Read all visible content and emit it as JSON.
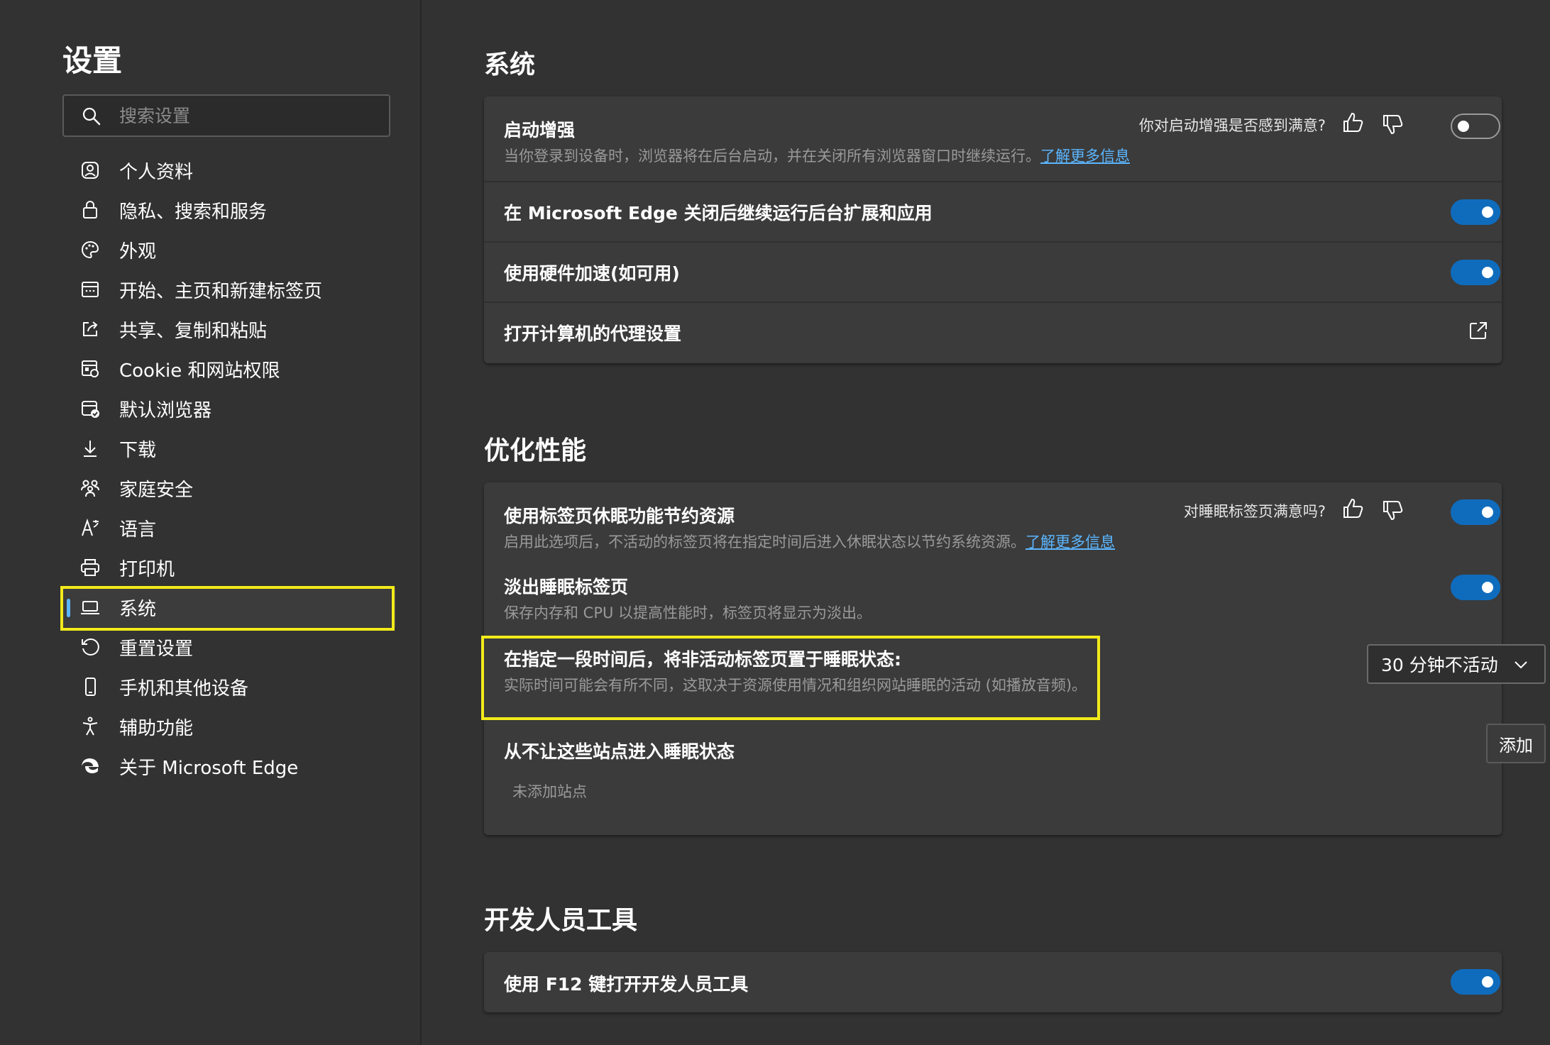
{
  "sidebar": {
    "title": "设置",
    "search_placeholder": "搜索设置",
    "items": [
      {
        "label": "个人资料",
        "icon": "profile-icon"
      },
      {
        "label": "隐私、搜索和服务",
        "icon": "lock-icon"
      },
      {
        "label": "外观",
        "icon": "palette-icon"
      },
      {
        "label": "开始、主页和新建标签页",
        "icon": "home-tab-icon"
      },
      {
        "label": "共享、复制和粘贴",
        "icon": "share-icon"
      },
      {
        "label": "Cookie 和网站权限",
        "icon": "cookie-icon"
      },
      {
        "label": "默认浏览器",
        "icon": "browser-icon"
      },
      {
        "label": "下载",
        "icon": "download-icon"
      },
      {
        "label": "家庭安全",
        "icon": "family-icon"
      },
      {
        "label": "语言",
        "icon": "language-icon"
      },
      {
        "label": "打印机",
        "icon": "printer-icon"
      },
      {
        "label": "系统",
        "icon": "laptop-icon",
        "active": true
      },
      {
        "label": "重置设置",
        "icon": "reset-icon"
      },
      {
        "label": "手机和其他设备",
        "icon": "phone-icon"
      },
      {
        "label": "辅助功能",
        "icon": "accessibility-icon"
      },
      {
        "label": "关于 Microsoft Edge",
        "icon": "edge-logo-icon"
      }
    ]
  },
  "system": {
    "title": "系统",
    "startup_boost": {
      "title": "启动增强",
      "desc": "当你登录到设备时，浏览器将在后台启动，并在关闭所有浏览器窗口时继续运行。",
      "link": "了解更多信息",
      "feedback": "你对启动增强是否感到满意?",
      "enabled": false
    },
    "background_apps": {
      "title": "在 Microsoft Edge 关闭后继续运行后台扩展和应用",
      "enabled": true
    },
    "hardware_accel": {
      "title": "使用硬件加速(如可用)",
      "enabled": true
    },
    "proxy": {
      "title": "打开计算机的代理设置"
    }
  },
  "performance": {
    "title": "优化性能",
    "sleeping_tabs": {
      "title": "使用标签页休眠功能节约资源",
      "desc": "启用此选项后，不活动的标签页将在指定时间后进入休眠状态以节约系统资源。",
      "link": "了解更多信息",
      "feedback": "对睡眠标签页满意吗?",
      "enabled": true
    },
    "fade_tabs": {
      "title": "淡出睡眠标签页",
      "desc": "保存内存和 CPU 以提高性能时，标签页将显示为淡出。",
      "enabled": true
    },
    "sleep_after": {
      "title": "在指定一段时间后，将非活动标签页置于睡眠状态:",
      "desc": "实际时间可能会有所不同，这取决于资源使用情况和组织网站睡眠的活动 (如播放音频)。",
      "selected": "30 分钟不活动"
    },
    "never_sleep": {
      "title": "从不让这些站点进入睡眠状态",
      "add_label": "添加",
      "empty": "未添加站点"
    }
  },
  "devtools": {
    "title": "开发人员工具",
    "f12": {
      "title": "使用 F12 键打开开发人员工具",
      "enabled": true
    }
  },
  "colors": {
    "accent": "#0f6cbd",
    "link": "#5bb6ff",
    "highlight": "#f2ea1a",
    "background": "#323232",
    "card": "#3b3b3b"
  }
}
